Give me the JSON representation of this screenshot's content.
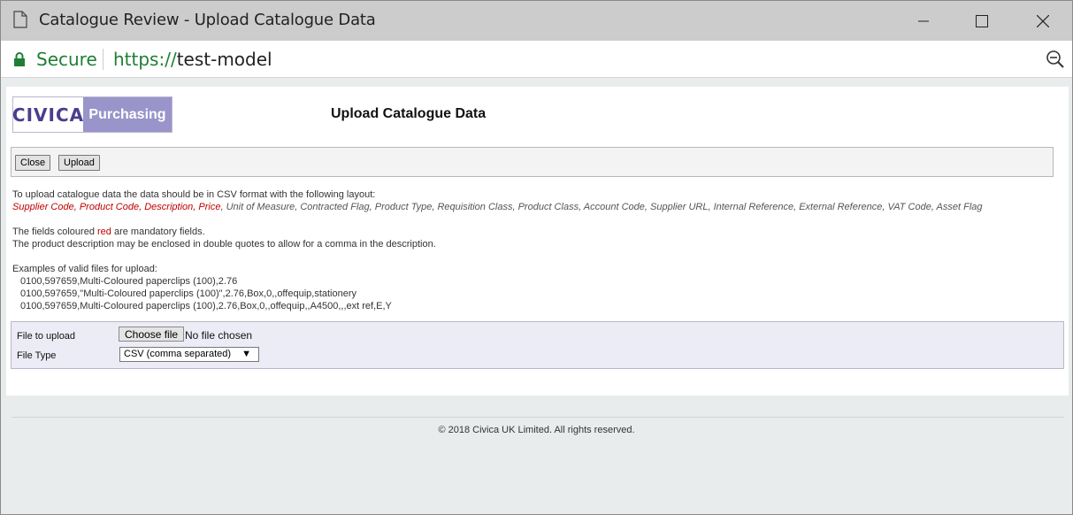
{
  "window": {
    "title": "Catalogue Review - Upload Catalogue Data"
  },
  "address_bar": {
    "secure_label": "Secure",
    "url_protocol": "https://",
    "url_host": "test-model"
  },
  "logo": {
    "brand": "CIVICA",
    "product": "Purchasing"
  },
  "page": {
    "title": "Upload Catalogue Data"
  },
  "toolbar": {
    "close_label": "Close",
    "upload_label": "Upload"
  },
  "instructions": {
    "intro": "To upload catalogue data the data should be in CSV format with the following layout:",
    "mandatory_fields": [
      "Supplier Code",
      "Product Code",
      "Description",
      "Price"
    ],
    "optional_fields": [
      "Unit of Measure",
      "Contracted Flag",
      "Product Type",
      "Requisition Class",
      "Product Class",
      "Account Code",
      "Supplier URL",
      "Internal Reference",
      "External Reference",
      "VAT Code",
      "Asset Flag"
    ],
    "mandatory_note_prefix": "The fields coloured ",
    "mandatory_note_red": "red",
    "mandatory_note_suffix": " are mandatory fields.",
    "quotes_note": "The product description may be enclosed in double quotes to allow for a comma in the description.",
    "examples_heading": "Examples of valid files for upload:",
    "examples": [
      "0100,597659,Multi-Coloured paperclips (100),2.76",
      "0100,597659,\"Multi-Coloured paperclips (100)\",2.76,Box,0,,offequip,stationery",
      "0100,597659,Multi-Coloured paperclips (100),2.76,Box,0,,offequip,,A4500,,,ext ref,E,Y"
    ]
  },
  "form": {
    "file_label": "File to upload",
    "choose_label": "Choose file",
    "no_file_text": "No file chosen",
    "type_label": "File Type",
    "type_selected": "CSV (comma separated)"
  },
  "footer": {
    "copyright": "© 2018 Civica UK Limited. All rights reserved."
  },
  "colors": {
    "secure_green": "#1e7e34",
    "mandatory_red": "#c00000",
    "logo_purple": "#9994c9"
  }
}
